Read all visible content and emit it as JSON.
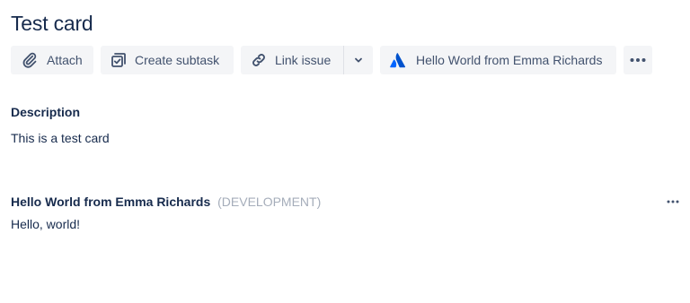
{
  "issue": {
    "title": "Test card"
  },
  "toolbar": {
    "attach_label": "Attach",
    "subtask_label": "Create subtask",
    "link_label": "Link issue",
    "app_label": "Hello World from Emma Richards"
  },
  "description": {
    "heading": "Description",
    "text": "This is a test card"
  },
  "app_panel": {
    "title": "Hello World from Emma Richards",
    "environment": "(DEVELOPMENT)",
    "body": "Hello, world!"
  },
  "icons": {
    "attach": "paperclip-icon",
    "subtask": "checkbox-icon",
    "link": "link-icon",
    "dropdown": "chevron-down-icon",
    "app": "atlassian-logo-icon",
    "more": "more-icon"
  },
  "colors": {
    "text": "#172b4d",
    "button_text": "#42526e",
    "button_bg": "#f4f5f7",
    "muted": "#a5adba",
    "brand": "#0052cc"
  }
}
